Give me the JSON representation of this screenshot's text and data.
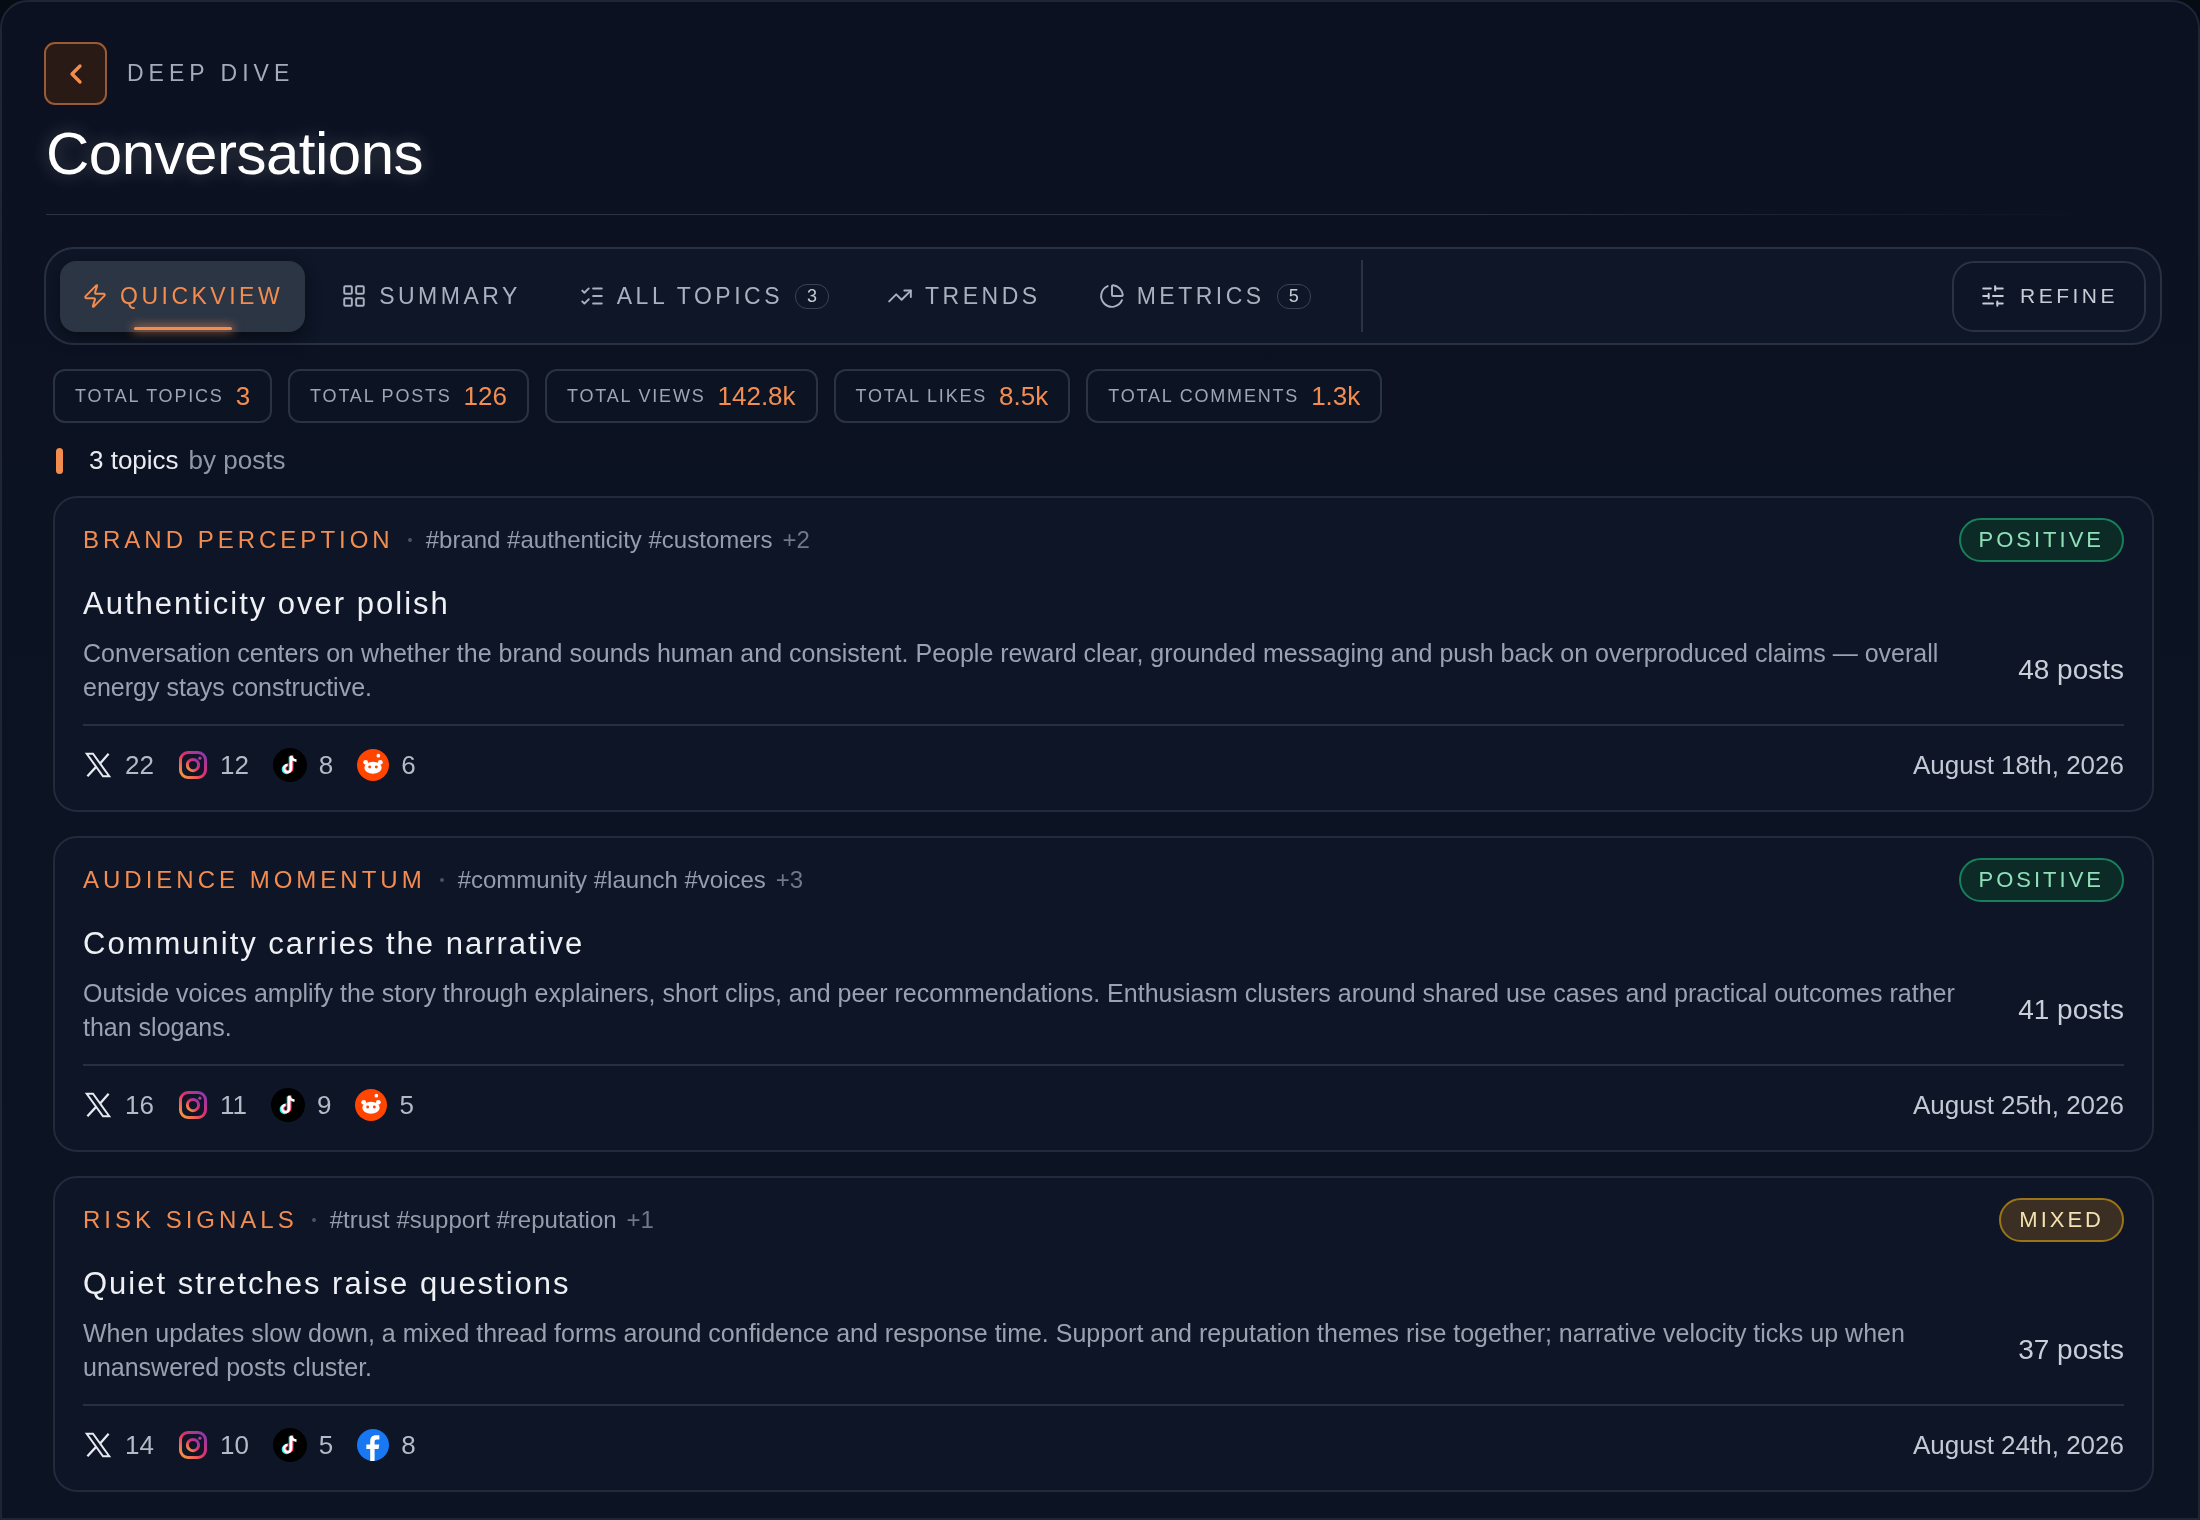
{
  "header": {
    "eyebrow": "DEEP DIVE",
    "title": "Conversations"
  },
  "tabs": [
    {
      "label": "QUICKVIEW",
      "selected": true
    },
    {
      "label": "SUMMARY",
      "selected": false
    },
    {
      "label": "ALL TOPICS",
      "count": "3",
      "selected": false
    },
    {
      "label": "TRENDS",
      "selected": false
    },
    {
      "label": "METRICS",
      "count": "5",
      "selected": false
    }
  ],
  "refine_button": "REFINE",
  "stats": [
    {
      "label": "TOTAL TOPICS",
      "value": "3"
    },
    {
      "label": "TOTAL POSTS",
      "value": "126"
    },
    {
      "label": "TOTAL VIEWS",
      "value": "142.8k"
    },
    {
      "label": "TOTAL LIKES",
      "value": "8.5k"
    },
    {
      "label": "TOTAL COMMENTS",
      "value": "1.3k"
    }
  ],
  "list_heading": {
    "count": "3 topics",
    "sort": "by posts"
  },
  "topics": [
    {
      "category": "BRAND PERCEPTION",
      "tags": "#brand #authenticity #customers",
      "more": "+2",
      "sentiment": {
        "label": "POSITIVE",
        "kind": "positive"
      },
      "title": "Authenticity over polish",
      "description": "Conversation centers on whether the brand sounds human and consistent. People reward clear, grounded messaging and push back on overproduced claims — overall energy stays constructive.",
      "posts": "48 posts",
      "platforms": [
        {
          "kind": "x",
          "count": "22"
        },
        {
          "kind": "instagram",
          "count": "12"
        },
        {
          "kind": "tiktok",
          "count": "8"
        },
        {
          "kind": "reddit",
          "count": "6"
        }
      ],
      "date": "August 18th, 2026"
    },
    {
      "category": "AUDIENCE MOMENTUM",
      "tags": "#community #launch #voices",
      "more": "+3",
      "sentiment": {
        "label": "POSITIVE",
        "kind": "positive"
      },
      "title": "Community carries the narrative",
      "description": "Outside voices amplify the story through explainers, short clips, and peer recommendations. Enthusiasm clusters around shared use cases and practical outcomes rather than slogans.",
      "posts": "41 posts",
      "platforms": [
        {
          "kind": "x",
          "count": "16"
        },
        {
          "kind": "instagram",
          "count": "11"
        },
        {
          "kind": "tiktok",
          "count": "9"
        },
        {
          "kind": "reddit",
          "count": "5"
        }
      ],
      "date": "August 25th, 2026"
    },
    {
      "category": "RISK SIGNALS",
      "tags": "#trust #support #reputation",
      "more": "+1",
      "sentiment": {
        "label": "MIXED",
        "kind": "mixed"
      },
      "title": "Quiet stretches raise questions",
      "description": "When updates slow down, a mixed thread forms around confidence and response time. Support and reputation themes rise together; narrative velocity ticks up when unanswered posts cluster.",
      "posts": "37 posts",
      "platforms": [
        {
          "kind": "x",
          "count": "14"
        },
        {
          "kind": "instagram",
          "count": "10"
        },
        {
          "kind": "tiktok",
          "count": "5"
        },
        {
          "kind": "facebook",
          "count": "8"
        }
      ],
      "date": "August 24th, 2026"
    }
  ]
}
